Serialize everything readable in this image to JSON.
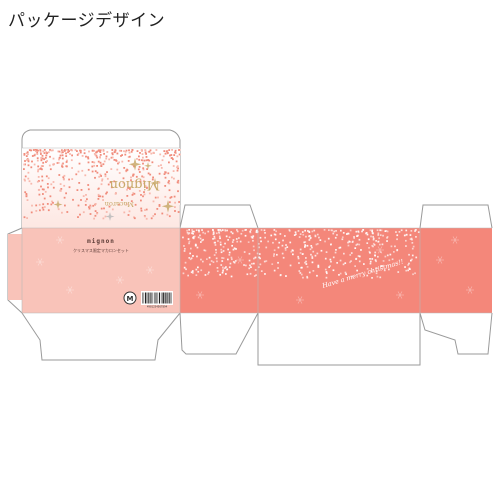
{
  "header": {
    "title": "パッケージデザイン"
  },
  "package": {
    "brand_top_flipped": "Mignon",
    "sub_top_flipped": "Macaron",
    "front_brand": "mignon",
    "front_tagline": "クリスマス限定マカロンセット",
    "side_message": "Have a merry christmas!!",
    "barcode_digits": "4901234567894",
    "logo_mark": "M"
  },
  "colors": {
    "salmon": "#f08c7c",
    "salmon_light": "#f7b8ad",
    "band_strong": "#f4877a",
    "band_soft": "#f9c3b9",
    "gold": "#c8a96a"
  },
  "icons": {
    "sparkle": "sparkle-icon",
    "recycle_logo": "recycle-logo-icon",
    "barcode": "barcode-icon"
  }
}
